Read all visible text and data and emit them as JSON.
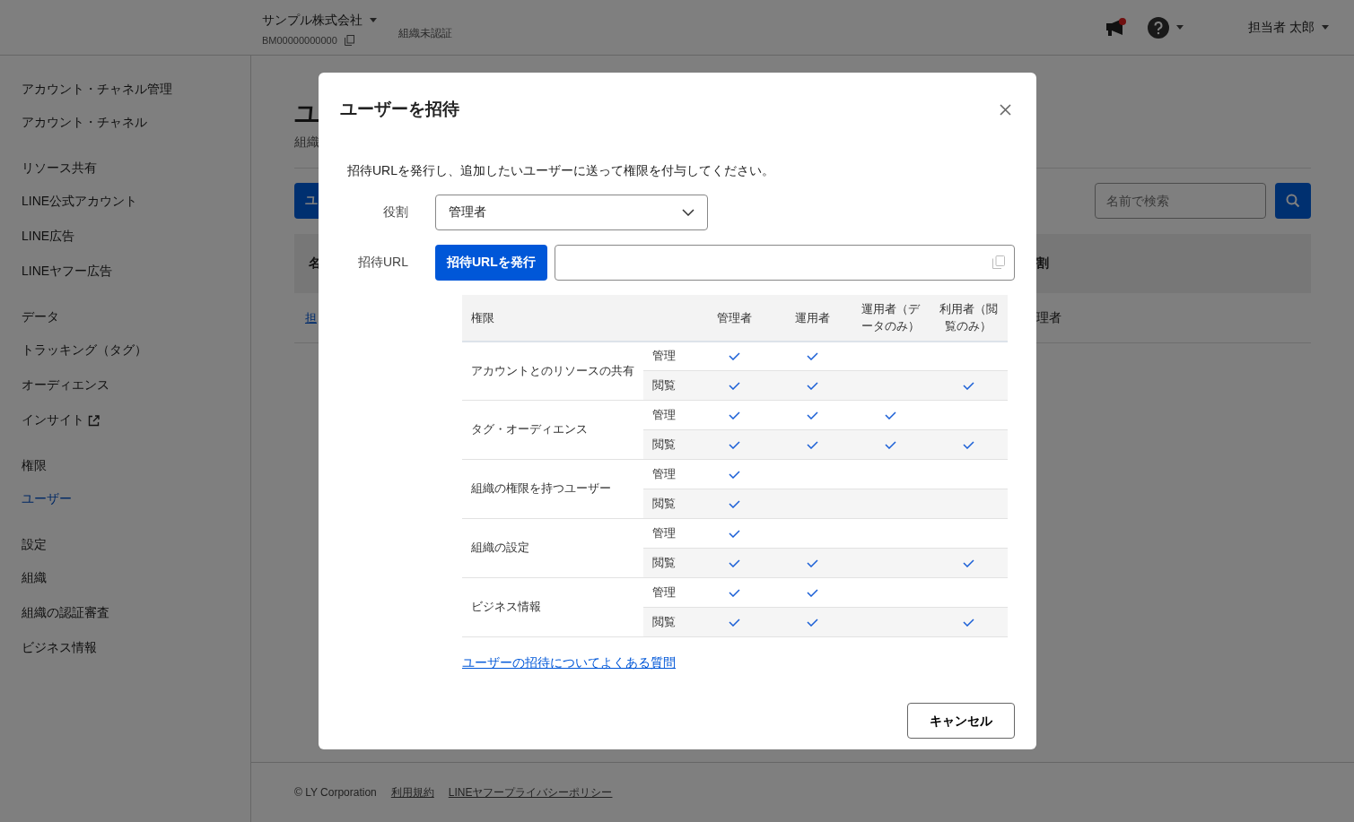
{
  "header": {
    "company": "サンプル株式会社",
    "business_id": "BM00000000000",
    "verification": "組織未認証",
    "notification_badge": true,
    "user": "担当者 太郎"
  },
  "sidebar": {
    "sections": [
      {
        "heading": "アカウント・チャネル管理",
        "items": [
          {
            "label": "アカウント・チャネル",
            "selected": false,
            "external": false
          }
        ]
      },
      {
        "heading": "リソース共有",
        "items": [
          {
            "label": "LINE公式アカウント",
            "selected": false,
            "external": false
          },
          {
            "label": "LINE広告",
            "selected": false,
            "external": false
          },
          {
            "label": "LINEヤフー広告",
            "selected": false,
            "external": false
          }
        ]
      },
      {
        "heading": "データ",
        "items": [
          {
            "label": "トラッキング（タグ）",
            "selected": false,
            "external": false
          },
          {
            "label": "オーディエンス",
            "selected": false,
            "external": false
          },
          {
            "label": "インサイト",
            "selected": false,
            "external": true
          }
        ]
      },
      {
        "heading": "権限",
        "items": [
          {
            "label": "ユーザー",
            "selected": true,
            "external": false
          }
        ]
      },
      {
        "heading": "設定",
        "items": [
          {
            "label": "組織",
            "selected": false,
            "external": false
          },
          {
            "label": "組織の認証審査",
            "selected": false,
            "external": false
          },
          {
            "label": "ビジネス情報",
            "selected": false,
            "external": false
          }
        ]
      }
    ]
  },
  "page": {
    "title": "ユ",
    "subtitle": "組織",
    "primary_button": "ユ",
    "search": {
      "placeholder": "名前で検索"
    },
    "table": {
      "columns": [
        "名",
        "割"
      ],
      "rows": [
        [
          "担",
          "理者"
        ]
      ]
    }
  },
  "footer": {
    "copyright": "© LY Corporation",
    "links": [
      "利用規約",
      "LINEヤフープライバシーポリシー"
    ]
  },
  "dialog": {
    "title": "ユーザーを招待",
    "description": "招待URLを発行し、追加したいユーザーに送って権限を付与してください。",
    "role_label": "役割",
    "role_value": "管理者",
    "url_label": "招待URL",
    "issue_button": "招待URLを発行",
    "permissions": {
      "columns": [
        "権限",
        "管理者",
        "運用者",
        "運用者（データのみ）",
        "利用者（閲覧のみ）"
      ],
      "groups": [
        {
          "name": "アカウントとのリソースの共有",
          "rows": [
            {
              "label": "管理",
              "checks": [
                true,
                true,
                false,
                false
              ]
            },
            {
              "label": "閲覧",
              "checks": [
                true,
                true,
                false,
                true
              ]
            }
          ]
        },
        {
          "name": "タグ・オーディエンス",
          "rows": [
            {
              "label": "管理",
              "checks": [
                true,
                true,
                true,
                false
              ]
            },
            {
              "label": "閲覧",
              "checks": [
                true,
                true,
                true,
                true
              ]
            }
          ]
        },
        {
          "name": "組織の権限を持つユーザー",
          "rows": [
            {
              "label": "管理",
              "checks": [
                true,
                false,
                false,
                false
              ]
            },
            {
              "label": "閲覧",
              "checks": [
                true,
                false,
                false,
                false
              ]
            }
          ]
        },
        {
          "name": "組織の設定",
          "rows": [
            {
              "label": "管理",
              "checks": [
                true,
                false,
                false,
                false
              ]
            },
            {
              "label": "閲覧",
              "checks": [
                true,
                true,
                false,
                true
              ]
            }
          ]
        },
        {
          "name": "ビジネス情報",
          "rows": [
            {
              "label": "管理",
              "checks": [
                true,
                true,
                false,
                false
              ]
            },
            {
              "label": "閲覧",
              "checks": [
                true,
                true,
                false,
                true
              ]
            }
          ]
        }
      ]
    },
    "faq_link": "ユーザーの招待についてよくある質問",
    "cancel_button": "キャンセル"
  }
}
